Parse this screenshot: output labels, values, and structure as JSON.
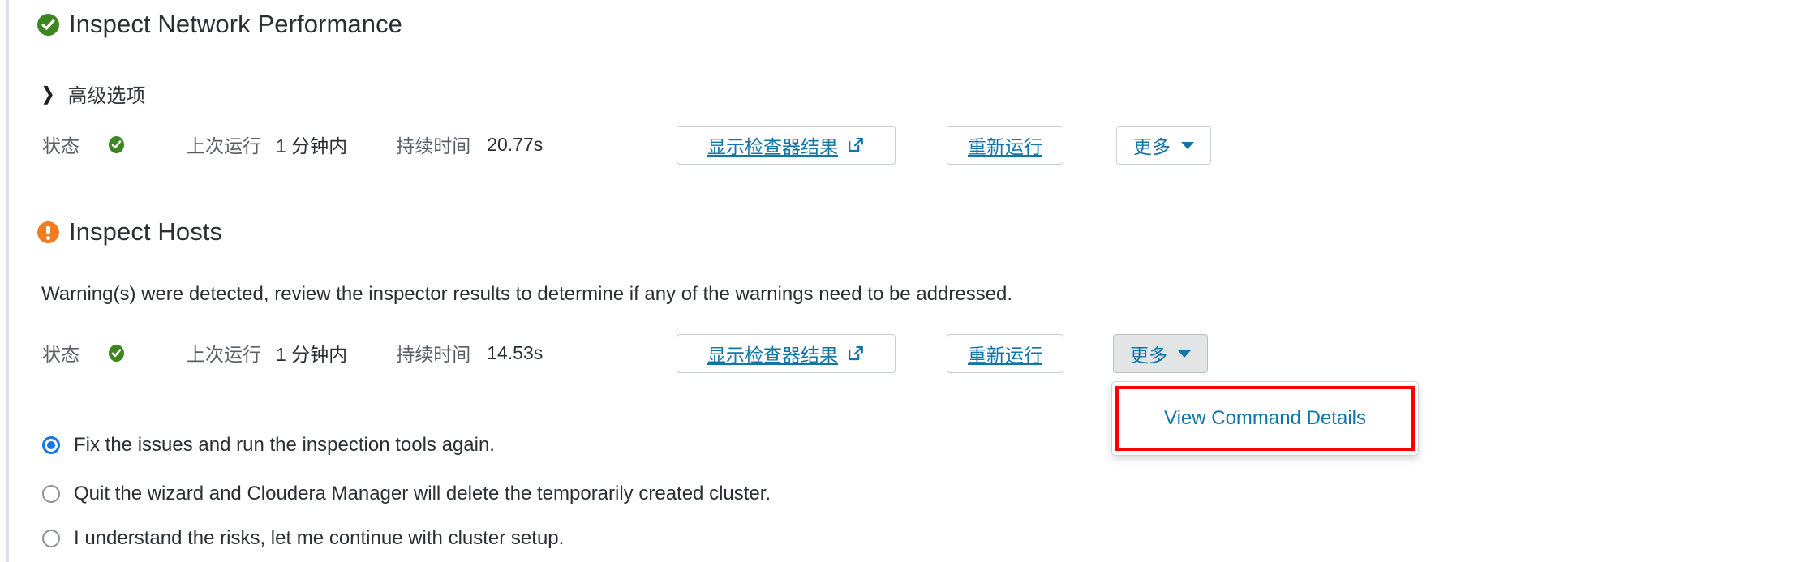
{
  "sections": [
    {
      "id": "inspect-network-performance",
      "status_icon": "check-circle-icon",
      "title": "Inspect Network Performance",
      "advanced": {
        "label": "高级选项",
        "chevron": "chevron-right-icon"
      },
      "status": {
        "state_label": "状态",
        "state_icon": "check-circle-icon",
        "last_run_label": "上次运行",
        "last_run_value": "1 分钟内",
        "duration_label": "持续时间",
        "duration_value": "20.77s"
      },
      "buttons": {
        "show_results": "显示检查器结果",
        "show_results_icon": "external-link-icon",
        "rerun": "重新运行",
        "more": "更多",
        "more_caret": "caret-down-icon"
      }
    },
    {
      "id": "inspect-hosts",
      "status_icon": "warning-circle-icon",
      "title": "Inspect Hosts",
      "message": "Warning(s) were detected, review the inspector results to determine if any of the warnings need to be addressed.",
      "status": {
        "state_label": "状态",
        "state_icon": "check-circle-icon",
        "last_run_label": "上次运行",
        "last_run_value": "1 分钟内",
        "duration_label": "持续时间",
        "duration_value": "14.53s"
      },
      "buttons": {
        "show_results": "显示检查器结果",
        "show_results_icon": "external-link-icon",
        "rerun": "重新运行",
        "more": "更多",
        "more_caret": "caret-down-icon"
      },
      "dropdown": {
        "open": true,
        "items": [
          "View Command Details"
        ]
      }
    }
  ],
  "radio_group": {
    "options": [
      {
        "label": "Fix the issues and run the inspection tools again.",
        "checked": true
      },
      {
        "label": "Quit the wizard and Cloudera Manager will delete the temporarily created cluster.",
        "checked": false
      },
      {
        "label": "I understand the risks, let me continue with cluster setup.",
        "checked": false
      }
    ]
  },
  "colors": {
    "success": "#3c8720",
    "warning": "#f47c20",
    "link": "#1275a8",
    "highlight": "#fb0007",
    "radio_selected": "#1a73e8"
  }
}
